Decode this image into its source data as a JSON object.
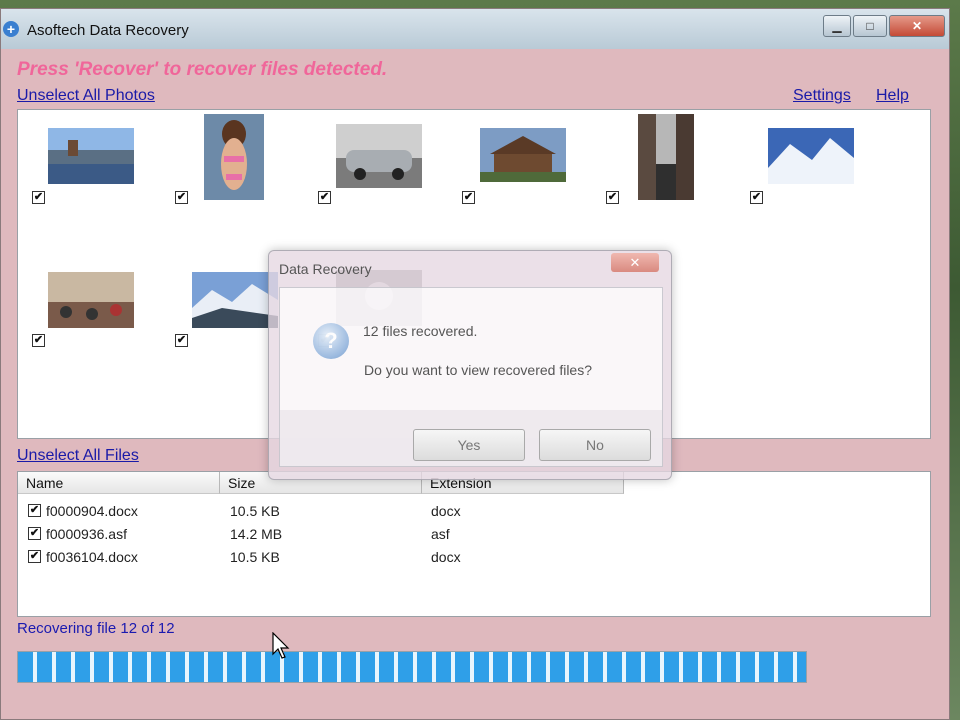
{
  "window": {
    "title": "Asoftech Data Recovery",
    "app_icon": "+"
  },
  "titlebar_buttons": {
    "minimize": "▁",
    "maximize": "□",
    "close": "✕"
  },
  "header": {
    "message": "Press 'Recover' to recover files detected.",
    "unselect_photos": "Unselect All Photos",
    "settings": "Settings",
    "help": "Help"
  },
  "photos": [
    {
      "name": "lake-town",
      "checked": true
    },
    {
      "name": "person-portrait",
      "checked": true
    },
    {
      "name": "silver-car",
      "checked": true
    },
    {
      "name": "wooden-chalet",
      "checked": true
    },
    {
      "name": "narrow-street",
      "checked": true
    },
    {
      "name": "snowy-mountains",
      "checked": true
    },
    {
      "name": "crowd-square",
      "checked": true
    },
    {
      "name": "mountain-ridge",
      "checked": true
    },
    {
      "name": "sketch-image",
      "checked": true
    }
  ],
  "files": {
    "unselect_label": "Unselect All Files",
    "columns": [
      "Name",
      "Size",
      "Extension"
    ],
    "rows": [
      {
        "name": "f0000904.docx",
        "size": "10.5 KB",
        "ext": "docx",
        "checked": true
      },
      {
        "name": "f0000936.asf",
        "size": "14.2 MB",
        "ext": "asf",
        "checked": true
      },
      {
        "name": "f0036104.docx",
        "size": "10.5 KB",
        "ext": "docx",
        "checked": true
      }
    ]
  },
  "status": {
    "text": "Recovering file 12 of 12",
    "progress_fraction": 1.0
  },
  "dialog": {
    "title": "Data Recovery",
    "close": "✕",
    "icon": "?",
    "line1": "12 files recovered.",
    "line2": "Do you want to view recovered files?",
    "yes": "Yes",
    "no": "No"
  },
  "colors": {
    "window_bg": "#dfb9be",
    "accent_pink": "#f0669a",
    "link_blue": "#1a1aa8",
    "progress_blue": "#2f9fe8"
  }
}
